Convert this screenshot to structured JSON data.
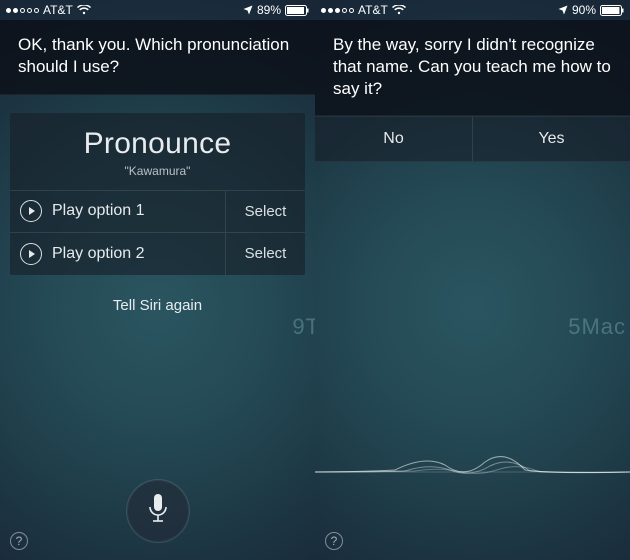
{
  "left": {
    "status": {
      "carrier": "AT&T",
      "battery": "89%"
    },
    "prompt": "OK, thank you. Which pronunciation should I use?",
    "card": {
      "title": "Pronounce",
      "word": "\"Kawamura\"",
      "options": [
        {
          "label": "Play option 1",
          "select": "Select"
        },
        {
          "label": "Play option 2",
          "select": "Select"
        }
      ]
    },
    "tell_again": "Tell Siri again",
    "help": "?"
  },
  "right": {
    "status": {
      "carrier": "AT&T",
      "battery": "90%"
    },
    "prompt": "By the way, sorry I didn't recognize that name. Can you teach me how to say it?",
    "no": "No",
    "yes": "Yes",
    "help": "?"
  },
  "watermark": {
    "left_part": "9T",
    "right_part": "5Mac"
  }
}
